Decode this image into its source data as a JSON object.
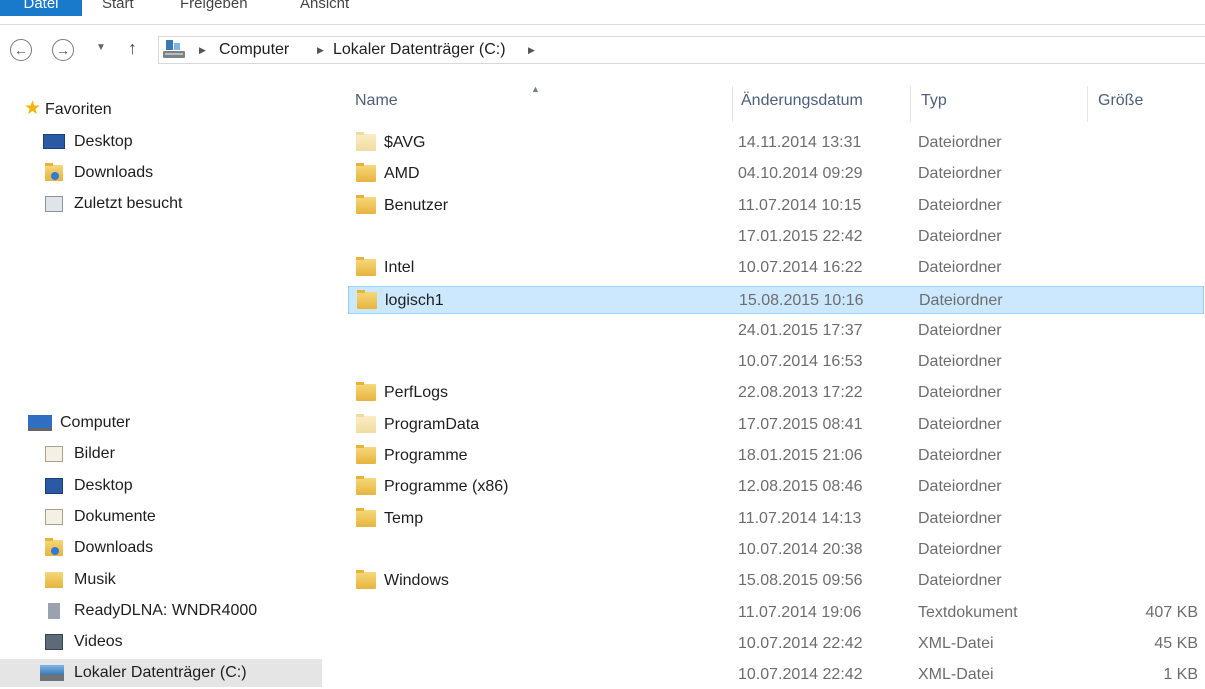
{
  "ribbon": {
    "tabs": [
      "Datei",
      "Start",
      "Freigeben",
      "Ansicht"
    ]
  },
  "address_bar": {
    "breadcrumbs": [
      "Computer",
      "Lokaler Datenträger (C:)"
    ]
  },
  "sidebar": {
    "favorites_label": "Favoriten",
    "favorites": [
      {
        "label": "Desktop",
        "icon": "desktop-icon"
      },
      {
        "label": "Downloads",
        "icon": "downloads-icon"
      },
      {
        "label": "Zuletzt besucht",
        "icon": "recent-places-icon"
      }
    ],
    "computer_label": "Computer",
    "computer_items": [
      {
        "label": "Bilder",
        "icon": "pictures-icon"
      },
      {
        "label": "Desktop",
        "icon": "desktop-folder-icon"
      },
      {
        "label": "Dokumente",
        "icon": "documents-icon"
      },
      {
        "label": "Downloads",
        "icon": "downloads-icon"
      },
      {
        "label": "Musik",
        "icon": "music-icon"
      },
      {
        "label": "ReadyDLNA: WNDR4000",
        "icon": "media-server-icon"
      },
      {
        "label": "Videos",
        "icon": "videos-icon"
      },
      {
        "label": "Lokaler Datenträger (C:)",
        "icon": "local-drive-icon",
        "selected": true
      }
    ]
  },
  "file_list": {
    "columns": [
      "Name",
      "Änderungsdatum",
      "Typ",
      "Größe"
    ],
    "rows": [
      {
        "name": "$AVG",
        "date": "14.11.2014 13:31",
        "type": "Dateiordner",
        "size": "",
        "icon": "folder-icon"
      },
      {
        "name": "AMD",
        "date": "04.10.2014 09:29",
        "type": "Dateiordner",
        "size": "",
        "icon": "folder-icon"
      },
      {
        "name": "Benutzer",
        "date": "11.07.2014 10:15",
        "type": "Dateiordner",
        "size": "",
        "icon": "folder-icon"
      },
      {
        "name": "",
        "date": "17.01.2015 22:42",
        "type": "Dateiordner",
        "size": "",
        "icon": ""
      },
      {
        "name": "Intel",
        "date": "10.07.2014 16:22",
        "type": "Dateiordner",
        "size": "",
        "icon": "folder-icon"
      },
      {
        "name": "logisch1",
        "date": "15.08.2015 10:16",
        "type": "Dateiordner",
        "size": "",
        "icon": "folder-icon",
        "selected": true
      },
      {
        "name": "",
        "date": "24.01.2015 17:37",
        "type": "Dateiordner",
        "size": "",
        "icon": ""
      },
      {
        "name": "",
        "date": "10.07.2014 16:53",
        "type": "Dateiordner",
        "size": "",
        "icon": ""
      },
      {
        "name": "PerfLogs",
        "date": "22.08.2013 17:22",
        "type": "Dateiordner",
        "size": "",
        "icon": "folder-icon"
      },
      {
        "name": "ProgramData",
        "date": "17.07.2015 08:41",
        "type": "Dateiordner",
        "size": "",
        "icon": "folder-icon"
      },
      {
        "name": "Programme",
        "date": "18.01.2015 21:06",
        "type": "Dateiordner",
        "size": "",
        "icon": "folder-icon"
      },
      {
        "name": "Programme (x86)",
        "date": "12.08.2015 08:46",
        "type": "Dateiordner",
        "size": "",
        "icon": "folder-icon"
      },
      {
        "name": "Temp",
        "date": "11.07.2014 14:13",
        "type": "Dateiordner",
        "size": "",
        "icon": "folder-icon"
      },
      {
        "name": "",
        "date": "10.07.2014 20:38",
        "type": "Dateiordner",
        "size": "",
        "icon": ""
      },
      {
        "name": "Windows",
        "date": "15.08.2015 09:56",
        "type": "Dateiordner",
        "size": "",
        "icon": "folder-icon"
      },
      {
        "name": "",
        "date": "11.07.2014 19:06",
        "type": "Textdokument",
        "size": "407 KB",
        "icon": ""
      },
      {
        "name": "",
        "date": "10.07.2014 22:42",
        "type": "XML-Datei",
        "size": "45 KB",
        "icon": ""
      },
      {
        "name": "",
        "date": "10.07.2014 22:42",
        "type": "XML-Datei",
        "size": "1 KB",
        "icon": ""
      }
    ]
  },
  "colors": {
    "accent": "#1979ca",
    "selection_fill": "#cce8ff",
    "selection_border": "#99d1ff",
    "header_text": "#4c607a",
    "sidebar_selected": "#e5e5e5"
  }
}
